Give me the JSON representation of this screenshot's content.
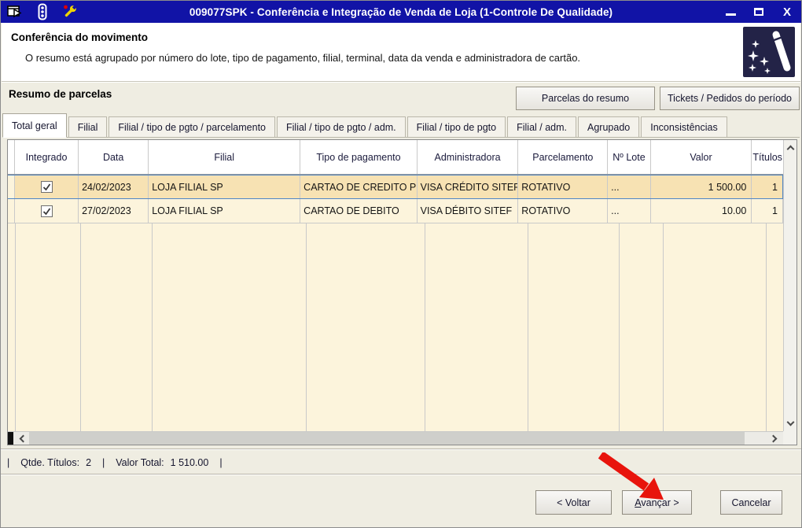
{
  "window": {
    "title": "009077SPK - Conferência e Integração de Venda de Loja (1-Controle De Qualidade)"
  },
  "header": {
    "title": "Conferência do movimento",
    "subtitle": "O resumo está agrupado por número do lote, tipo de pagamento, filial, terminal, data da venda e administradora de cartão."
  },
  "summary": {
    "label": "Resumo de parcelas",
    "parcelas_button": "Parcelas do resumo",
    "tickets_button": "Tickets / Pedidos do período"
  },
  "tabs": [
    {
      "label": "Total geral",
      "active": true
    },
    {
      "label": "Filial",
      "active": false
    },
    {
      "label": "Filial / tipo de pgto / parcelamento",
      "active": false
    },
    {
      "label": "Filial / tipo de pgto / adm.",
      "active": false
    },
    {
      "label": "Filial / tipo de pgto",
      "active": false
    },
    {
      "label": "Filial / adm.",
      "active": false
    },
    {
      "label": "Agrupado",
      "active": false
    },
    {
      "label": "Inconsistências",
      "active": false
    }
  ],
  "grid": {
    "columns": [
      "Integrado",
      "Data",
      "Filial",
      "Tipo de pagamento",
      "Administradora",
      "Parcelamento",
      "Nº Lote",
      "Valor",
      "Títulos"
    ],
    "rows": [
      {
        "integrado": true,
        "data": "24/02/2023",
        "filial": "LOJA FILIAL SP",
        "tipo": "CARTAO DE CREDITO P",
        "adm": "VISA CRÉDITO SITEF",
        "parcelamento": "ROTATIVO",
        "lote": "...",
        "valor": "1 500.00",
        "titulos": "1",
        "selected": true
      },
      {
        "integrado": true,
        "data": "27/02/2023",
        "filial": "LOJA FILIAL SP",
        "tipo": "CARTAO DE DEBITO",
        "adm": "VISA DÉBITO SITEF",
        "parcelamento": "ROTATIVO",
        "lote": "...",
        "valor": "10.00",
        "titulos": "1",
        "selected": false
      }
    ]
  },
  "status_bar": {
    "sep": "|",
    "qtde_label": "Qtde. Títulos:",
    "qtde_value": "2",
    "valor_label": "Valor Total:",
    "valor_value": "1 510.00"
  },
  "footer": {
    "voltar": "< Voltar",
    "avancar_accel": "A",
    "avancar_rest": "vançar >",
    "cancelar": "Cancelar"
  },
  "colors": {
    "titlebar": "#1113A6",
    "selected_row": "#F7E2B3",
    "row": "#FCF4DC",
    "selection_border": "#4F86C6",
    "content_bg": "#EFEDE2",
    "arrow": "#E8140C",
    "wand_bg": "#232347"
  }
}
